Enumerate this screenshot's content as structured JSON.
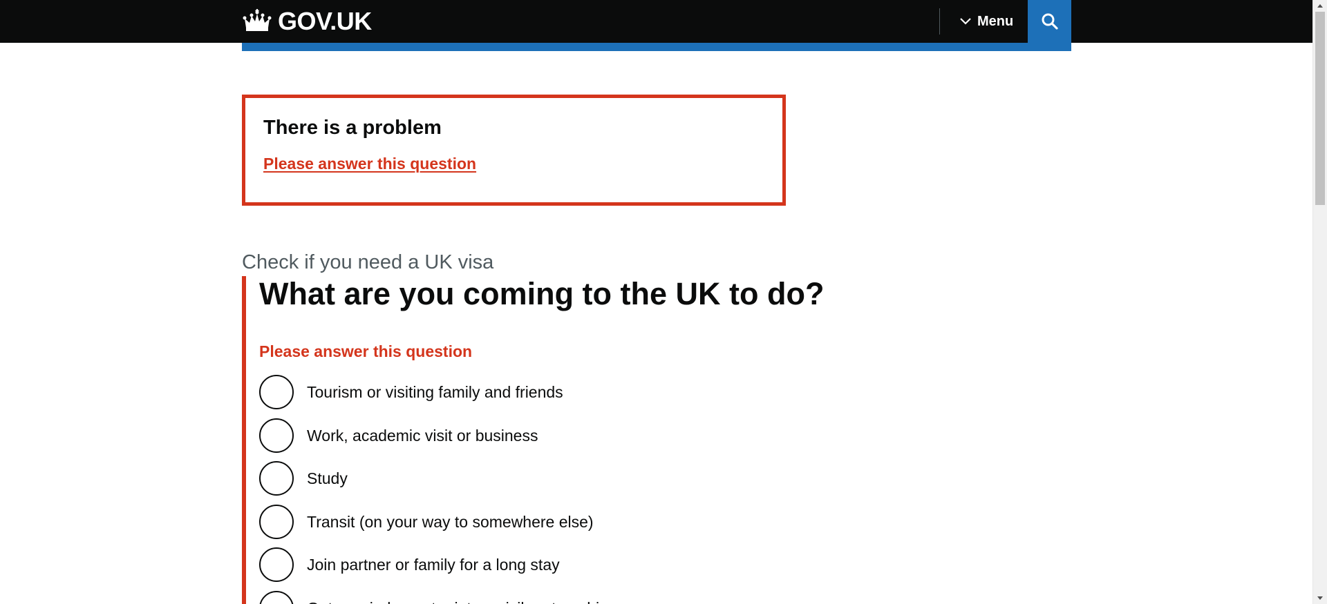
{
  "header": {
    "logo_text": "GOV.UK",
    "menu_label": "Menu",
    "search_icon": "search-icon",
    "brand_color": "#1d70b8"
  },
  "error_summary": {
    "title": "There is a problem",
    "link_text": "Please answer this question",
    "error_color": "#d4351c"
  },
  "form": {
    "caption": "Check if you need a UK visa",
    "question": "What are you coming to the UK to do?",
    "error_message": "Please answer this question",
    "options": [
      {
        "label": "Tourism or visiting family and friends"
      },
      {
        "label": "Work, academic visit or business"
      },
      {
        "label": "Study"
      },
      {
        "label": "Transit (on your way to somewhere else)"
      },
      {
        "label": "Join partner or family for a long stay"
      },
      {
        "label": "Get married or enter into a civil partnership"
      }
    ]
  }
}
